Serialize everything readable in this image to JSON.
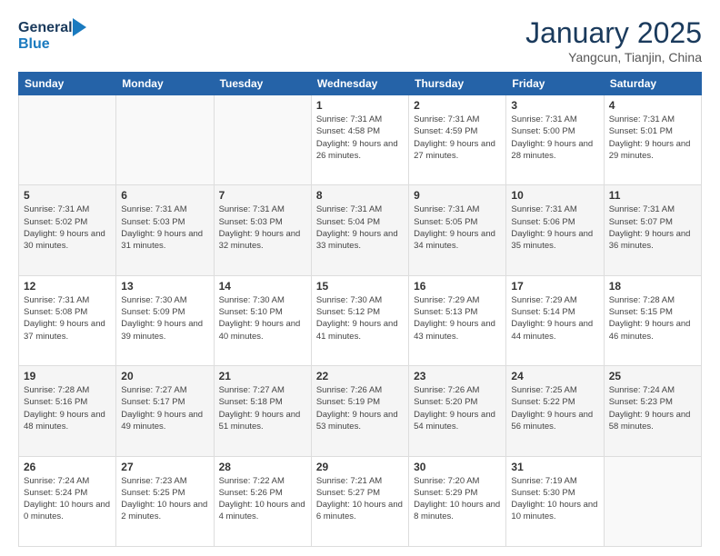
{
  "header": {
    "logo_line1": "General",
    "logo_line2": "Blue",
    "title": "January 2025",
    "subtitle": "Yangcun, Tianjin, China"
  },
  "weekdays": [
    "Sunday",
    "Monday",
    "Tuesday",
    "Wednesday",
    "Thursday",
    "Friday",
    "Saturday"
  ],
  "weeks": [
    [
      {
        "day": "",
        "info": ""
      },
      {
        "day": "",
        "info": ""
      },
      {
        "day": "",
        "info": ""
      },
      {
        "day": "1",
        "info": "Sunrise: 7:31 AM\nSunset: 4:58 PM\nDaylight: 9 hours and 26 minutes."
      },
      {
        "day": "2",
        "info": "Sunrise: 7:31 AM\nSunset: 4:59 PM\nDaylight: 9 hours and 27 minutes."
      },
      {
        "day": "3",
        "info": "Sunrise: 7:31 AM\nSunset: 5:00 PM\nDaylight: 9 hours and 28 minutes."
      },
      {
        "day": "4",
        "info": "Sunrise: 7:31 AM\nSunset: 5:01 PM\nDaylight: 9 hours and 29 minutes."
      }
    ],
    [
      {
        "day": "5",
        "info": "Sunrise: 7:31 AM\nSunset: 5:02 PM\nDaylight: 9 hours and 30 minutes."
      },
      {
        "day": "6",
        "info": "Sunrise: 7:31 AM\nSunset: 5:03 PM\nDaylight: 9 hours and 31 minutes."
      },
      {
        "day": "7",
        "info": "Sunrise: 7:31 AM\nSunset: 5:03 PM\nDaylight: 9 hours and 32 minutes."
      },
      {
        "day": "8",
        "info": "Sunrise: 7:31 AM\nSunset: 5:04 PM\nDaylight: 9 hours and 33 minutes."
      },
      {
        "day": "9",
        "info": "Sunrise: 7:31 AM\nSunset: 5:05 PM\nDaylight: 9 hours and 34 minutes."
      },
      {
        "day": "10",
        "info": "Sunrise: 7:31 AM\nSunset: 5:06 PM\nDaylight: 9 hours and 35 minutes."
      },
      {
        "day": "11",
        "info": "Sunrise: 7:31 AM\nSunset: 5:07 PM\nDaylight: 9 hours and 36 minutes."
      }
    ],
    [
      {
        "day": "12",
        "info": "Sunrise: 7:31 AM\nSunset: 5:08 PM\nDaylight: 9 hours and 37 minutes."
      },
      {
        "day": "13",
        "info": "Sunrise: 7:30 AM\nSunset: 5:09 PM\nDaylight: 9 hours and 39 minutes."
      },
      {
        "day": "14",
        "info": "Sunrise: 7:30 AM\nSunset: 5:10 PM\nDaylight: 9 hours and 40 minutes."
      },
      {
        "day": "15",
        "info": "Sunrise: 7:30 AM\nSunset: 5:12 PM\nDaylight: 9 hours and 41 minutes."
      },
      {
        "day": "16",
        "info": "Sunrise: 7:29 AM\nSunset: 5:13 PM\nDaylight: 9 hours and 43 minutes."
      },
      {
        "day": "17",
        "info": "Sunrise: 7:29 AM\nSunset: 5:14 PM\nDaylight: 9 hours and 44 minutes."
      },
      {
        "day": "18",
        "info": "Sunrise: 7:28 AM\nSunset: 5:15 PM\nDaylight: 9 hours and 46 minutes."
      }
    ],
    [
      {
        "day": "19",
        "info": "Sunrise: 7:28 AM\nSunset: 5:16 PM\nDaylight: 9 hours and 48 minutes."
      },
      {
        "day": "20",
        "info": "Sunrise: 7:27 AM\nSunset: 5:17 PM\nDaylight: 9 hours and 49 minutes."
      },
      {
        "day": "21",
        "info": "Sunrise: 7:27 AM\nSunset: 5:18 PM\nDaylight: 9 hours and 51 minutes."
      },
      {
        "day": "22",
        "info": "Sunrise: 7:26 AM\nSunset: 5:19 PM\nDaylight: 9 hours and 53 minutes."
      },
      {
        "day": "23",
        "info": "Sunrise: 7:26 AM\nSunset: 5:20 PM\nDaylight: 9 hours and 54 minutes."
      },
      {
        "day": "24",
        "info": "Sunrise: 7:25 AM\nSunset: 5:22 PM\nDaylight: 9 hours and 56 minutes."
      },
      {
        "day": "25",
        "info": "Sunrise: 7:24 AM\nSunset: 5:23 PM\nDaylight: 9 hours and 58 minutes."
      }
    ],
    [
      {
        "day": "26",
        "info": "Sunrise: 7:24 AM\nSunset: 5:24 PM\nDaylight: 10 hours and 0 minutes."
      },
      {
        "day": "27",
        "info": "Sunrise: 7:23 AM\nSunset: 5:25 PM\nDaylight: 10 hours and 2 minutes."
      },
      {
        "day": "28",
        "info": "Sunrise: 7:22 AM\nSunset: 5:26 PM\nDaylight: 10 hours and 4 minutes."
      },
      {
        "day": "29",
        "info": "Sunrise: 7:21 AM\nSunset: 5:27 PM\nDaylight: 10 hours and 6 minutes."
      },
      {
        "day": "30",
        "info": "Sunrise: 7:20 AM\nSunset: 5:29 PM\nDaylight: 10 hours and 8 minutes."
      },
      {
        "day": "31",
        "info": "Sunrise: 7:19 AM\nSunset: 5:30 PM\nDaylight: 10 hours and 10 minutes."
      },
      {
        "day": "",
        "info": ""
      }
    ]
  ]
}
